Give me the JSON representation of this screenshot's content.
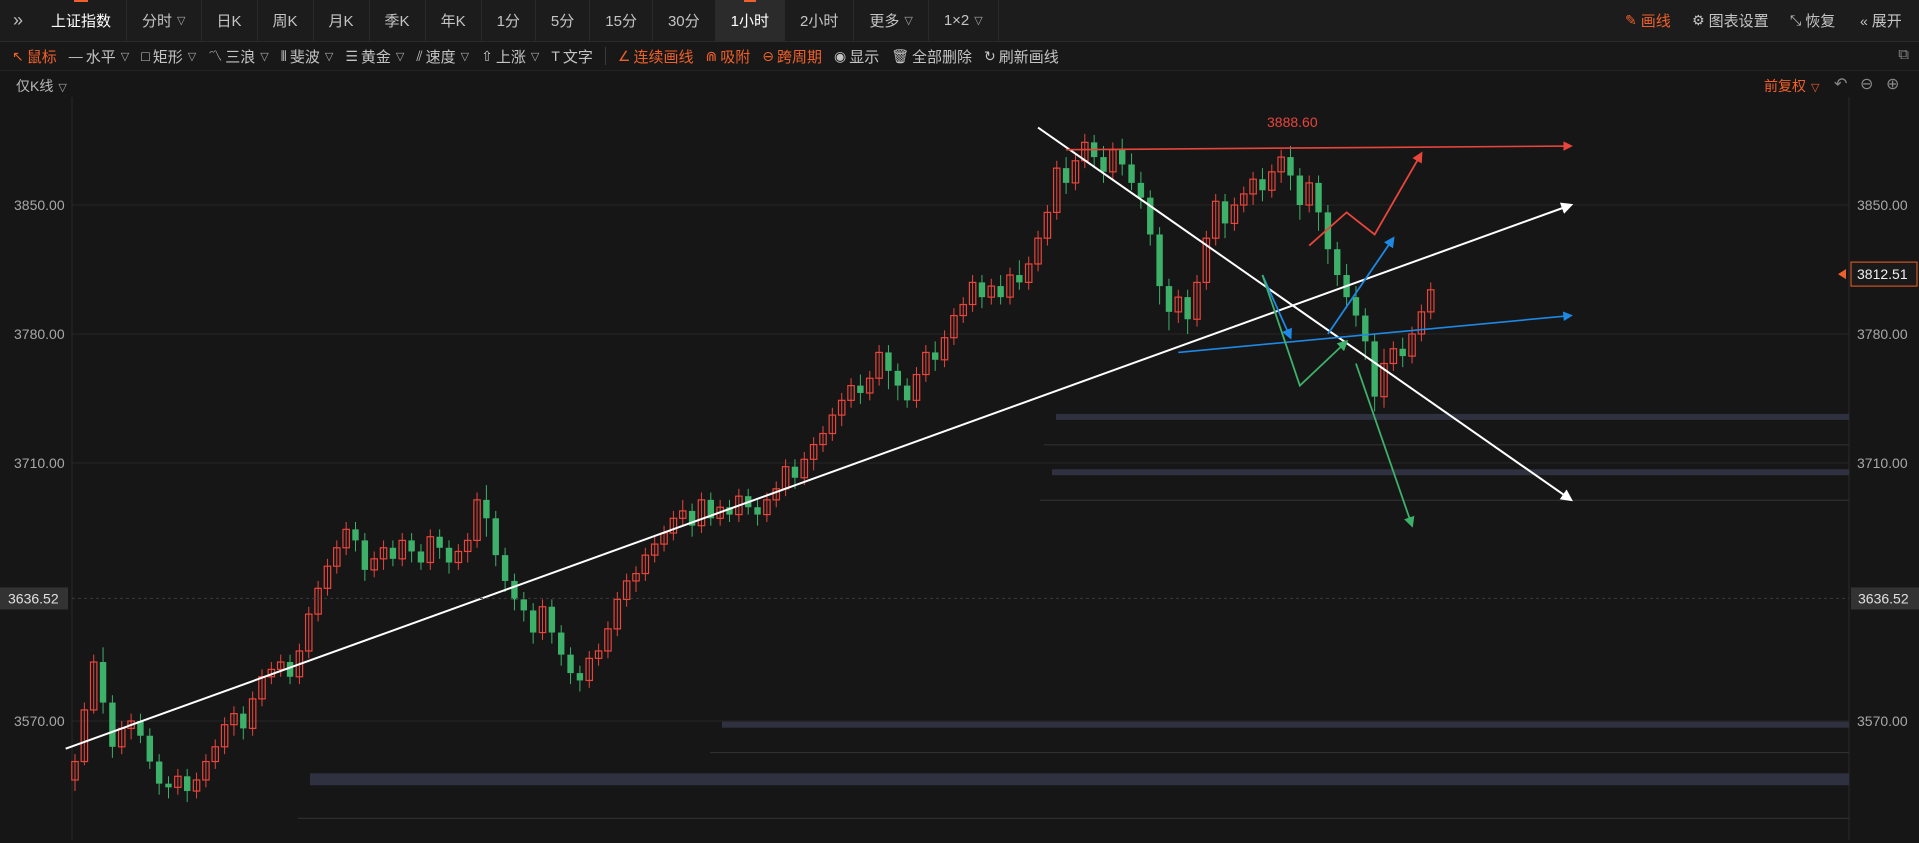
{
  "toolbar": {
    "tabs": [
      {
        "label": "上证指数",
        "key": "index"
      },
      {
        "label": "分时",
        "key": "fenshi",
        "dropdown": true
      },
      {
        "label": "日K",
        "key": "day"
      },
      {
        "label": "周K",
        "key": "week"
      },
      {
        "label": "月K",
        "key": "month"
      },
      {
        "label": "季K",
        "key": "season"
      },
      {
        "label": "年K",
        "key": "year"
      },
      {
        "label": "1分",
        "key": "m1"
      },
      {
        "label": "5分",
        "key": "m5"
      },
      {
        "label": "15分",
        "key": "m15"
      },
      {
        "label": "30分",
        "key": "m30"
      },
      {
        "label": "1小时",
        "key": "h1",
        "active": true
      },
      {
        "label": "2小时",
        "key": "h2"
      },
      {
        "label": "更多",
        "key": "more",
        "dropdown": true
      },
      {
        "label": "1×2",
        "key": "layout",
        "dropdown": true
      }
    ],
    "right": {
      "draw": "画线",
      "settings": "图表设置",
      "restore": "恢复",
      "expand": "展开"
    }
  },
  "drawing_tools": {
    "mouse": "鼠标",
    "hline": "水平",
    "rect": "矩形",
    "wave3": "三浪",
    "fib": "斐波",
    "gold": "黄金",
    "speed": "速度",
    "up": "上涨",
    "text": "文字",
    "continuous": "连续画线",
    "snap": "吸附",
    "cross_period": "跨周期",
    "show": "显示",
    "delete_all": "全部删除",
    "refresh": "刷新画线"
  },
  "chart_header": {
    "kline_only": "仅K线",
    "fuquan": "前复权"
  },
  "chart": {
    "price_axis": {
      "labels": [
        "3850.00",
        "3780.00",
        "3710.00",
        "3570.00"
      ]
    },
    "crosshair_price": "3636.52",
    "last_price": "3812.51",
    "high_label": "3888.60",
    "colors": {
      "up": "#e8453c",
      "down": "#3db06a",
      "bg": "#161616",
      "accent": "#f0602a"
    }
  },
  "chart_data": {
    "type": "candlestick",
    "ylim": [
      3545,
      3905
    ],
    "y_ticks": [
      3850,
      3780,
      3710,
      3570
    ],
    "high": 3888.6,
    "last": 3812.51,
    "crosshair": 3636.52,
    "candles": [
      [
        3538,
        3548,
        3532,
        3552
      ],
      [
        3548,
        3576,
        3546,
        3580
      ],
      [
        3576,
        3602,
        3574,
        3606
      ],
      [
        3602,
        3580,
        3574,
        3610
      ],
      [
        3580,
        3556,
        3550,
        3584
      ],
      [
        3556,
        3566,
        3552,
        3570
      ],
      [
        3566,
        3570,
        3560,
        3574
      ],
      [
        3570,
        3562,
        3558,
        3574
      ],
      [
        3562,
        3548,
        3544,
        3566
      ],
      [
        3548,
        3536,
        3530,
        3552
      ],
      [
        3536,
        3534,
        3528,
        3540
      ],
      [
        3534,
        3540,
        3530,
        3544
      ],
      [
        3540,
        3532,
        3526,
        3544
      ],
      [
        3532,
        3538,
        3528,
        3542
      ],
      [
        3538,
        3548,
        3534,
        3552
      ],
      [
        3548,
        3556,
        3544,
        3560
      ],
      [
        3556,
        3568,
        3552,
        3572
      ],
      [
        3568,
        3574,
        3562,
        3578
      ],
      [
        3574,
        3566,
        3560,
        3578
      ],
      [
        3566,
        3582,
        3562,
        3586
      ],
      [
        3582,
        3594,
        3578,
        3598
      ],
      [
        3594,
        3598,
        3590,
        3602
      ],
      [
        3598,
        3602,
        3594,
        3606
      ],
      [
        3602,
        3594,
        3590,
        3606
      ],
      [
        3594,
        3608,
        3590,
        3612
      ],
      [
        3608,
        3628,
        3604,
        3632
      ],
      [
        3628,
        3642,
        3624,
        3646
      ],
      [
        3642,
        3654,
        3638,
        3658
      ],
      [
        3654,
        3664,
        3650,
        3668
      ],
      [
        3664,
        3674,
        3660,
        3678
      ],
      [
        3674,
        3668,
        3662,
        3678
      ],
      [
        3668,
        3652,
        3646,
        3672
      ],
      [
        3652,
        3658,
        3648,
        3662
      ],
      [
        3658,
        3664,
        3652,
        3668
      ],
      [
        3664,
        3658,
        3654,
        3668
      ],
      [
        3658,
        3668,
        3654,
        3672
      ],
      [
        3668,
        3662,
        3656,
        3672
      ],
      [
        3662,
        3656,
        3652,
        3666
      ],
      [
        3656,
        3670,
        3652,
        3674
      ],
      [
        3670,
        3664,
        3658,
        3674
      ],
      [
        3664,
        3656,
        3650,
        3668
      ],
      [
        3656,
        3662,
        3652,
        3666
      ],
      [
        3662,
        3668,
        3656,
        3672
      ],
      [
        3668,
        3690,
        3664,
        3694
      ],
      [
        3690,
        3680,
        3670,
        3698
      ],
      [
        3680,
        3660,
        3654,
        3684
      ],
      [
        3660,
        3646,
        3640,
        3664
      ],
      [
        3646,
        3636,
        3630,
        3650
      ],
      [
        3636,
        3630,
        3624,
        3640
      ],
      [
        3630,
        3618,
        3612,
        3634
      ],
      [
        3618,
        3632,
        3614,
        3636
      ],
      [
        3632,
        3618,
        3612,
        3636
      ],
      [
        3618,
        3606,
        3600,
        3622
      ],
      [
        3606,
        3596,
        3590,
        3610
      ],
      [
        3596,
        3592,
        3586,
        3600
      ],
      [
        3592,
        3604,
        3588,
        3608
      ],
      [
        3604,
        3608,
        3600,
        3612
      ],
      [
        3608,
        3620,
        3604,
        3624
      ],
      [
        3620,
        3636,
        3616,
        3640
      ],
      [
        3636,
        3646,
        3632,
        3650
      ],
      [
        3646,
        3650,
        3640,
        3654
      ],
      [
        3650,
        3660,
        3646,
        3664
      ],
      [
        3660,
        3666,
        3656,
        3670
      ],
      [
        3666,
        3672,
        3662,
        3676
      ],
      [
        3672,
        3680,
        3668,
        3684
      ],
      [
        3680,
        3684,
        3676,
        3690
      ],
      [
        3684,
        3676,
        3670,
        3688
      ],
      [
        3676,
        3690,
        3672,
        3694
      ],
      [
        3690,
        3680,
        3676,
        3694
      ],
      [
        3680,
        3686,
        3676,
        3690
      ],
      [
        3686,
        3682,
        3678,
        3690
      ],
      [
        3682,
        3692,
        3678,
        3696
      ],
      [
        3692,
        3686,
        3682,
        3696
      ],
      [
        3686,
        3682,
        3676,
        3690
      ],
      [
        3682,
        3690,
        3678,
        3694
      ],
      [
        3690,
        3696,
        3686,
        3700
      ],
      [
        3696,
        3708,
        3692,
        3712
      ],
      [
        3708,
        3702,
        3696,
        3712
      ],
      [
        3702,
        3712,
        3698,
        3716
      ],
      [
        3712,
        3720,
        3706,
        3724
      ],
      [
        3720,
        3726,
        3716,
        3730
      ],
      [
        3726,
        3736,
        3722,
        3740
      ],
      [
        3736,
        3744,
        3730,
        3748
      ],
      [
        3744,
        3752,
        3740,
        3756
      ],
      [
        3752,
        3748,
        3742,
        3758
      ],
      [
        3748,
        3756,
        3744,
        3760
      ],
      [
        3756,
        3770,
        3752,
        3774
      ],
      [
        3770,
        3760,
        3750,
        3774
      ],
      [
        3760,
        3752,
        3744,
        3764
      ],
      [
        3752,
        3744,
        3740,
        3756
      ],
      [
        3744,
        3758,
        3740,
        3762
      ],
      [
        3758,
        3770,
        3754,
        3774
      ],
      [
        3770,
        3766,
        3760,
        3776
      ],
      [
        3766,
        3778,
        3762,
        3782
      ],
      [
        3778,
        3790,
        3774,
        3794
      ],
      [
        3790,
        3796,
        3786,
        3800
      ],
      [
        3796,
        3808,
        3792,
        3812
      ],
      [
        3808,
        3800,
        3794,
        3812
      ],
      [
        3800,
        3806,
        3796,
        3810
      ],
      [
        3806,
        3800,
        3796,
        3812
      ],
      [
        3800,
        3812,
        3796,
        3816
      ],
      [
        3812,
        3808,
        3804,
        3820
      ],
      [
        3808,
        3818,
        3804,
        3822
      ],
      [
        3818,
        3832,
        3814,
        3836
      ],
      [
        3832,
        3846,
        3828,
        3850
      ],
      [
        3846,
        3870,
        3842,
        3874
      ],
      [
        3870,
        3862,
        3856,
        3876
      ],
      [
        3862,
        3874,
        3858,
        3878
      ],
      [
        3874,
        3884,
        3870,
        3888.6
      ],
      [
        3884,
        3876,
        3870,
        3888
      ],
      [
        3876,
        3868,
        3862,
        3882
      ],
      [
        3868,
        3880,
        3864,
        3884
      ],
      [
        3880,
        3872,
        3866,
        3886
      ],
      [
        3872,
        3862,
        3858,
        3878
      ],
      [
        3862,
        3854,
        3848,
        3868
      ],
      [
        3854,
        3834,
        3828,
        3858
      ],
      [
        3834,
        3806,
        3796,
        3838
      ],
      [
        3806,
        3792,
        3782,
        3810
      ],
      [
        3792,
        3800,
        3786,
        3804
      ],
      [
        3800,
        3788,
        3780,
        3804
      ],
      [
        3788,
        3808,
        3784,
        3812
      ],
      [
        3808,
        3832,
        3804,
        3836
      ],
      [
        3832,
        3852,
        3828,
        3856
      ],
      [
        3852,
        3840,
        3832,
        3856
      ],
      [
        3840,
        3850,
        3836,
        3854
      ],
      [
        3850,
        3856,
        3846,
        3860
      ],
      [
        3856,
        3864,
        3850,
        3868
      ],
      [
        3864,
        3858,
        3852,
        3870
      ],
      [
        3858,
        3868,
        3854,
        3872
      ],
      [
        3868,
        3876,
        3862,
        3880
      ],
      [
        3876,
        3866,
        3858,
        3882
      ],
      [
        3866,
        3850,
        3842,
        3870
      ],
      [
        3850,
        3862,
        3846,
        3866
      ],
      [
        3862,
        3846,
        3836,
        3866
      ],
      [
        3846,
        3826,
        3818,
        3850
      ],
      [
        3826,
        3812,
        3806,
        3830
      ],
      [
        3812,
        3800,
        3794,
        3818
      ],
      [
        3800,
        3790,
        3784,
        3806
      ],
      [
        3790,
        3776,
        3766,
        3794
      ],
      [
        3776,
        3746,
        3738,
        3780
      ],
      [
        3746,
        3764,
        3740,
        3772
      ],
      [
        3764,
        3772,
        3760,
        3776
      ],
      [
        3772,
        3768,
        3762,
        3778
      ],
      [
        3768,
        3780,
        3764,
        3784
      ],
      [
        3780,
        3792,
        3776,
        3796
      ],
      [
        3792,
        3804,
        3788,
        3808
      ]
    ],
    "support_bands": [
      3735,
      3705,
      3568,
      3540
    ],
    "annotations": [
      {
        "type": "trendline",
        "color": "#ffffff",
        "from": [
          -1,
          3555
        ],
        "to": [
          160,
          3850
        ]
      },
      {
        "type": "trendline",
        "color": "#ffffff",
        "from": [
          103,
          3892
        ],
        "to": [
          160,
          3690
        ]
      },
      {
        "type": "trendline",
        "color": "#e8453c",
        "from": [
          106,
          3880
        ],
        "to": [
          160,
          3882
        ]
      },
      {
        "type": "trendline",
        "color": "#1e88e5",
        "from": [
          118,
          3770
        ],
        "to": [
          160,
          3790
        ]
      },
      {
        "type": "path",
        "color": "#e8453c",
        "points": [
          [
            132,
            3828
          ],
          [
            136,
            3846
          ],
          [
            139,
            3834
          ],
          [
            144,
            3878
          ]
        ]
      },
      {
        "type": "path",
        "color": "#1e88e5",
        "points": [
          [
            127,
            3812
          ],
          [
            130,
            3778
          ]
        ]
      },
      {
        "type": "path",
        "color": "#1e88e5",
        "points": [
          [
            134,
            3780
          ],
          [
            141,
            3832
          ]
        ]
      },
      {
        "type": "path",
        "color": "#3db06a",
        "points": [
          [
            127,
            3812
          ],
          [
            131,
            3752
          ],
          [
            136,
            3776
          ]
        ]
      },
      {
        "type": "path",
        "color": "#3db06a",
        "points": [
          [
            137,
            3764
          ],
          [
            143,
            3676
          ]
        ]
      }
    ]
  }
}
